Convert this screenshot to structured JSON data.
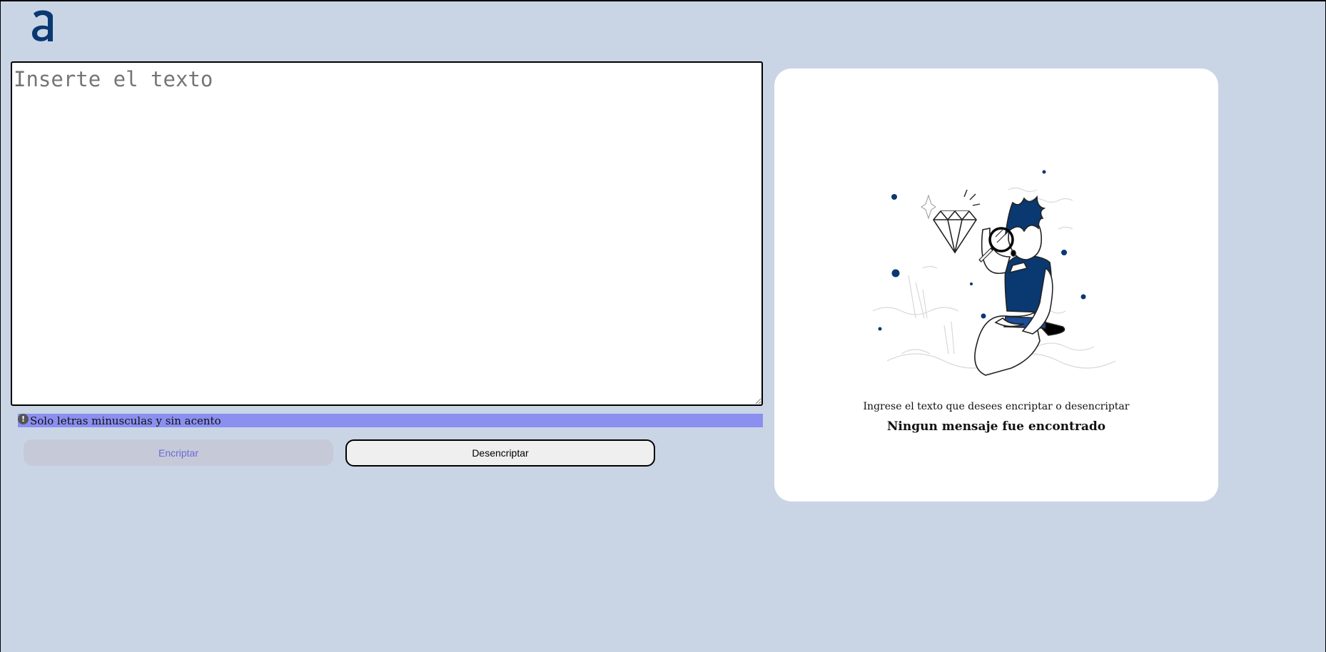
{
  "header": {
    "logo_icon": "alura-logo-icon"
  },
  "editor": {
    "placeholder": "Inserte el texto",
    "value": ""
  },
  "hint": {
    "icon": "info-icon",
    "icon_glyph": "!",
    "text": "Solo letras minusculas y sin acento"
  },
  "actions": {
    "encrypt_label": "Encriptar",
    "decrypt_label": "Desencriptar"
  },
  "result_panel": {
    "illustration": "person-with-magnifier-illustration",
    "subtitle": "Ingrese el texto que desees encriptar o desencriptar",
    "title": "Ningun mensaje fue encontrado"
  },
  "colors": {
    "background": "#c9d5e5",
    "brand": "#0a3871",
    "hint_bar": "#8b8ff0",
    "encrypt_button": "#c6c9d8",
    "encrypt_text": "#6a6ad6"
  }
}
